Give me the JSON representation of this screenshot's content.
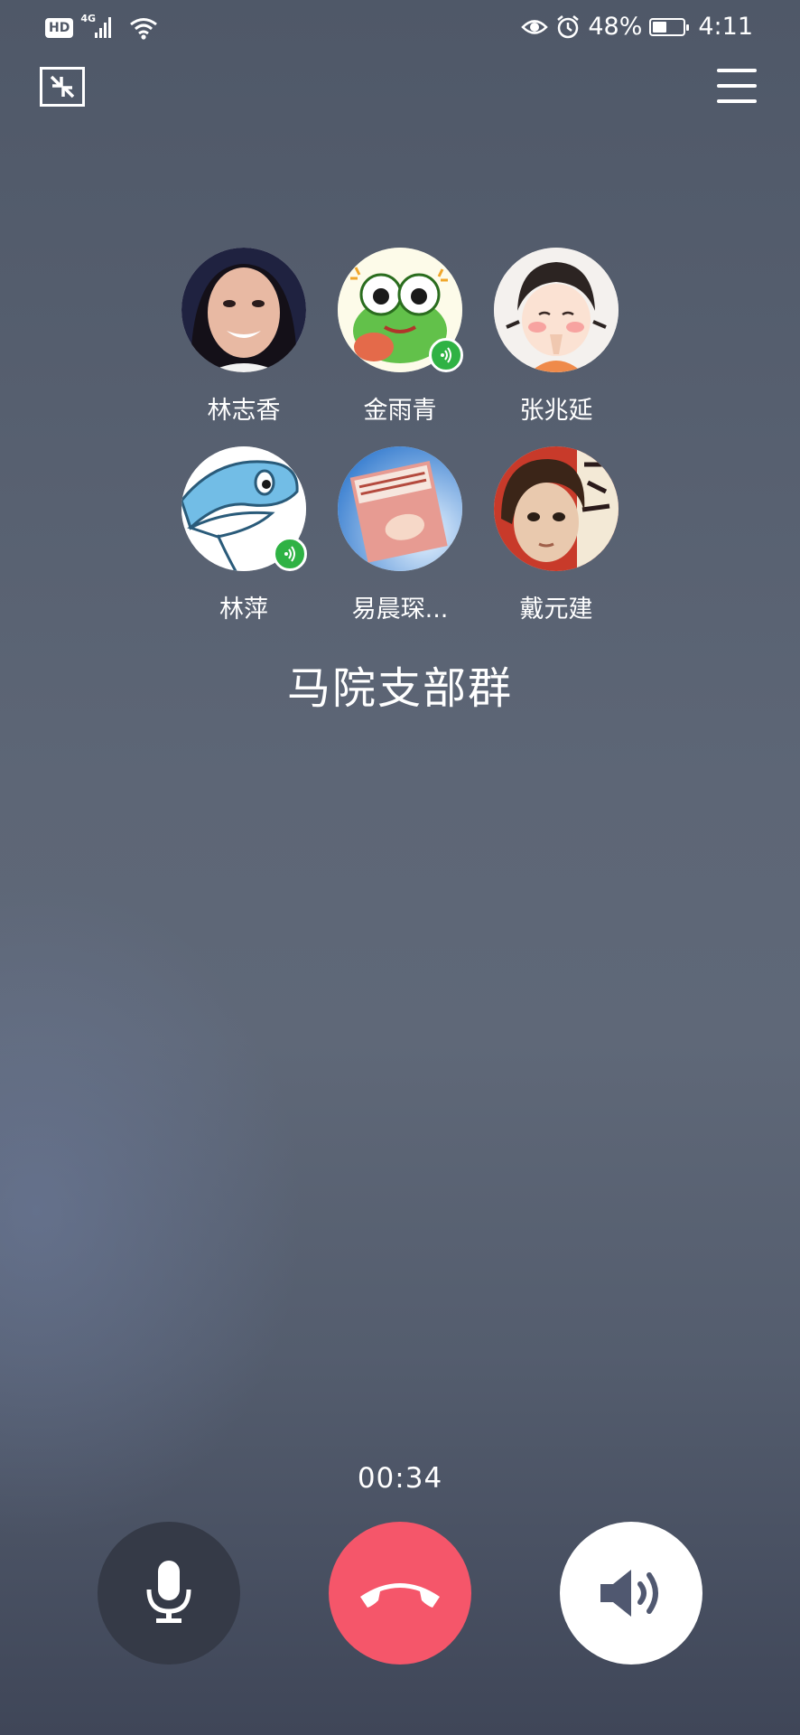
{
  "status_bar": {
    "hd": "HD",
    "network": "4G",
    "battery_percent": "48%",
    "battery_level": 0.48,
    "time": "4:11",
    "icons": [
      "signal-icon",
      "wifi-icon",
      "eye-icon",
      "alarm-icon",
      "battery-icon"
    ]
  },
  "header": {
    "minimize_icon": "minimize-icon",
    "menu_icon": "menu-icon"
  },
  "participants": [
    {
      "name": "林志香",
      "speaking": false
    },
    {
      "name": "金雨青",
      "speaking": true
    },
    {
      "name": "张兆延",
      "speaking": false
    },
    {
      "name": "林萍",
      "speaking": true
    },
    {
      "name": "易晨琛...",
      "speaking": false
    },
    {
      "name": "戴元建",
      "speaking": false
    }
  ],
  "group_name": "马院支部群",
  "call": {
    "duration": "00:34"
  },
  "controls": {
    "mic_icon": "microphone-icon",
    "hangup_icon": "hang-up-icon",
    "speaker_icon": "speaker-icon"
  },
  "colors": {
    "hangup": "#f5566a",
    "mic_bg": "#353a47",
    "speaker_bg": "#ffffff",
    "speaking_badge": "#2fb244"
  }
}
